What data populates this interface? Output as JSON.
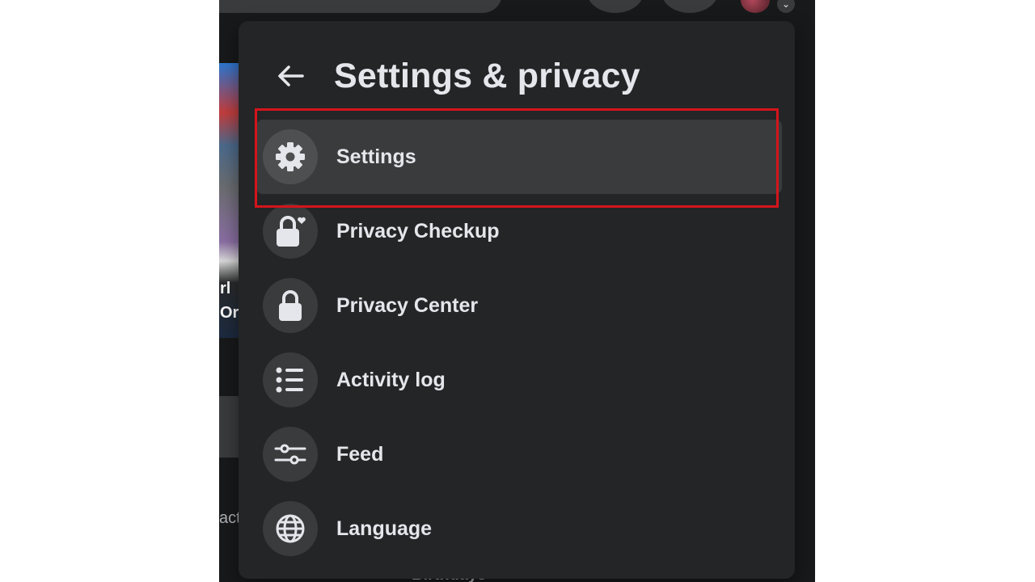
{
  "background": {
    "story_text_1": "rl",
    "story_text_2": "Or",
    "side_text": "act",
    "bottom_text": "Birthdays"
  },
  "panel": {
    "title": "Settings & privacy",
    "back_icon": "arrow-left-icon",
    "items": [
      {
        "label": "Settings",
        "icon": "gear-icon",
        "active": true
      },
      {
        "label": "Privacy Checkup",
        "icon": "lock-heart-icon",
        "active": false
      },
      {
        "label": "Privacy Center",
        "icon": "lock-icon",
        "active": false
      },
      {
        "label": "Activity log",
        "icon": "list-icon",
        "active": false
      },
      {
        "label": "Feed",
        "icon": "sliders-icon",
        "active": false
      },
      {
        "label": "Language",
        "icon": "globe-icon",
        "active": false
      }
    ]
  },
  "colors": {
    "panel_bg": "#242526",
    "item_hover": "#3a3b3c",
    "text": "#e4e6eb",
    "highlight_box": "#d4141c"
  }
}
